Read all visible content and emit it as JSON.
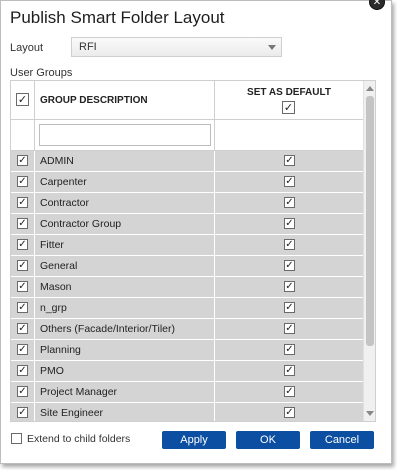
{
  "dialog": {
    "title": "Publish Smart Folder Layout",
    "close_glyph": "✕"
  },
  "layout": {
    "label": "Layout",
    "selected": "RFI"
  },
  "user_groups": {
    "label": "User Groups",
    "columns": {
      "select_all_checked": true,
      "description_header": "GROUP DESCRIPTION",
      "default_header": "SET AS DEFAULT",
      "default_all_checked": true
    },
    "filter_value": "",
    "rows": [
      {
        "name": "ADMIN",
        "selected": true,
        "is_default": true
      },
      {
        "name": "Carpenter",
        "selected": true,
        "is_default": true
      },
      {
        "name": "Contractor",
        "selected": true,
        "is_default": true
      },
      {
        "name": "Contractor Group",
        "selected": true,
        "is_default": true
      },
      {
        "name": "Fitter",
        "selected": true,
        "is_default": true
      },
      {
        "name": "General",
        "selected": true,
        "is_default": true
      },
      {
        "name": "Mason",
        "selected": true,
        "is_default": true
      },
      {
        "name": "n_grp",
        "selected": true,
        "is_default": true
      },
      {
        "name": "Others (Facade/Interior/Tiler)",
        "selected": true,
        "is_default": true
      },
      {
        "name": "Planning",
        "selected": true,
        "is_default": true
      },
      {
        "name": "PMO",
        "selected": true,
        "is_default": true
      },
      {
        "name": "Project Manager",
        "selected": true,
        "is_default": true
      },
      {
        "name": "Site Engineer",
        "selected": true,
        "is_default": true
      }
    ]
  },
  "footer": {
    "extend_label": "Extend to child folders",
    "extend_checked": false,
    "apply_label": "Apply",
    "ok_label": "OK",
    "cancel_label": "Cancel"
  },
  "colors": {
    "primary_button": "#0b4ea2",
    "row_background": "#d4d4d4"
  },
  "check_glyph": "✓"
}
